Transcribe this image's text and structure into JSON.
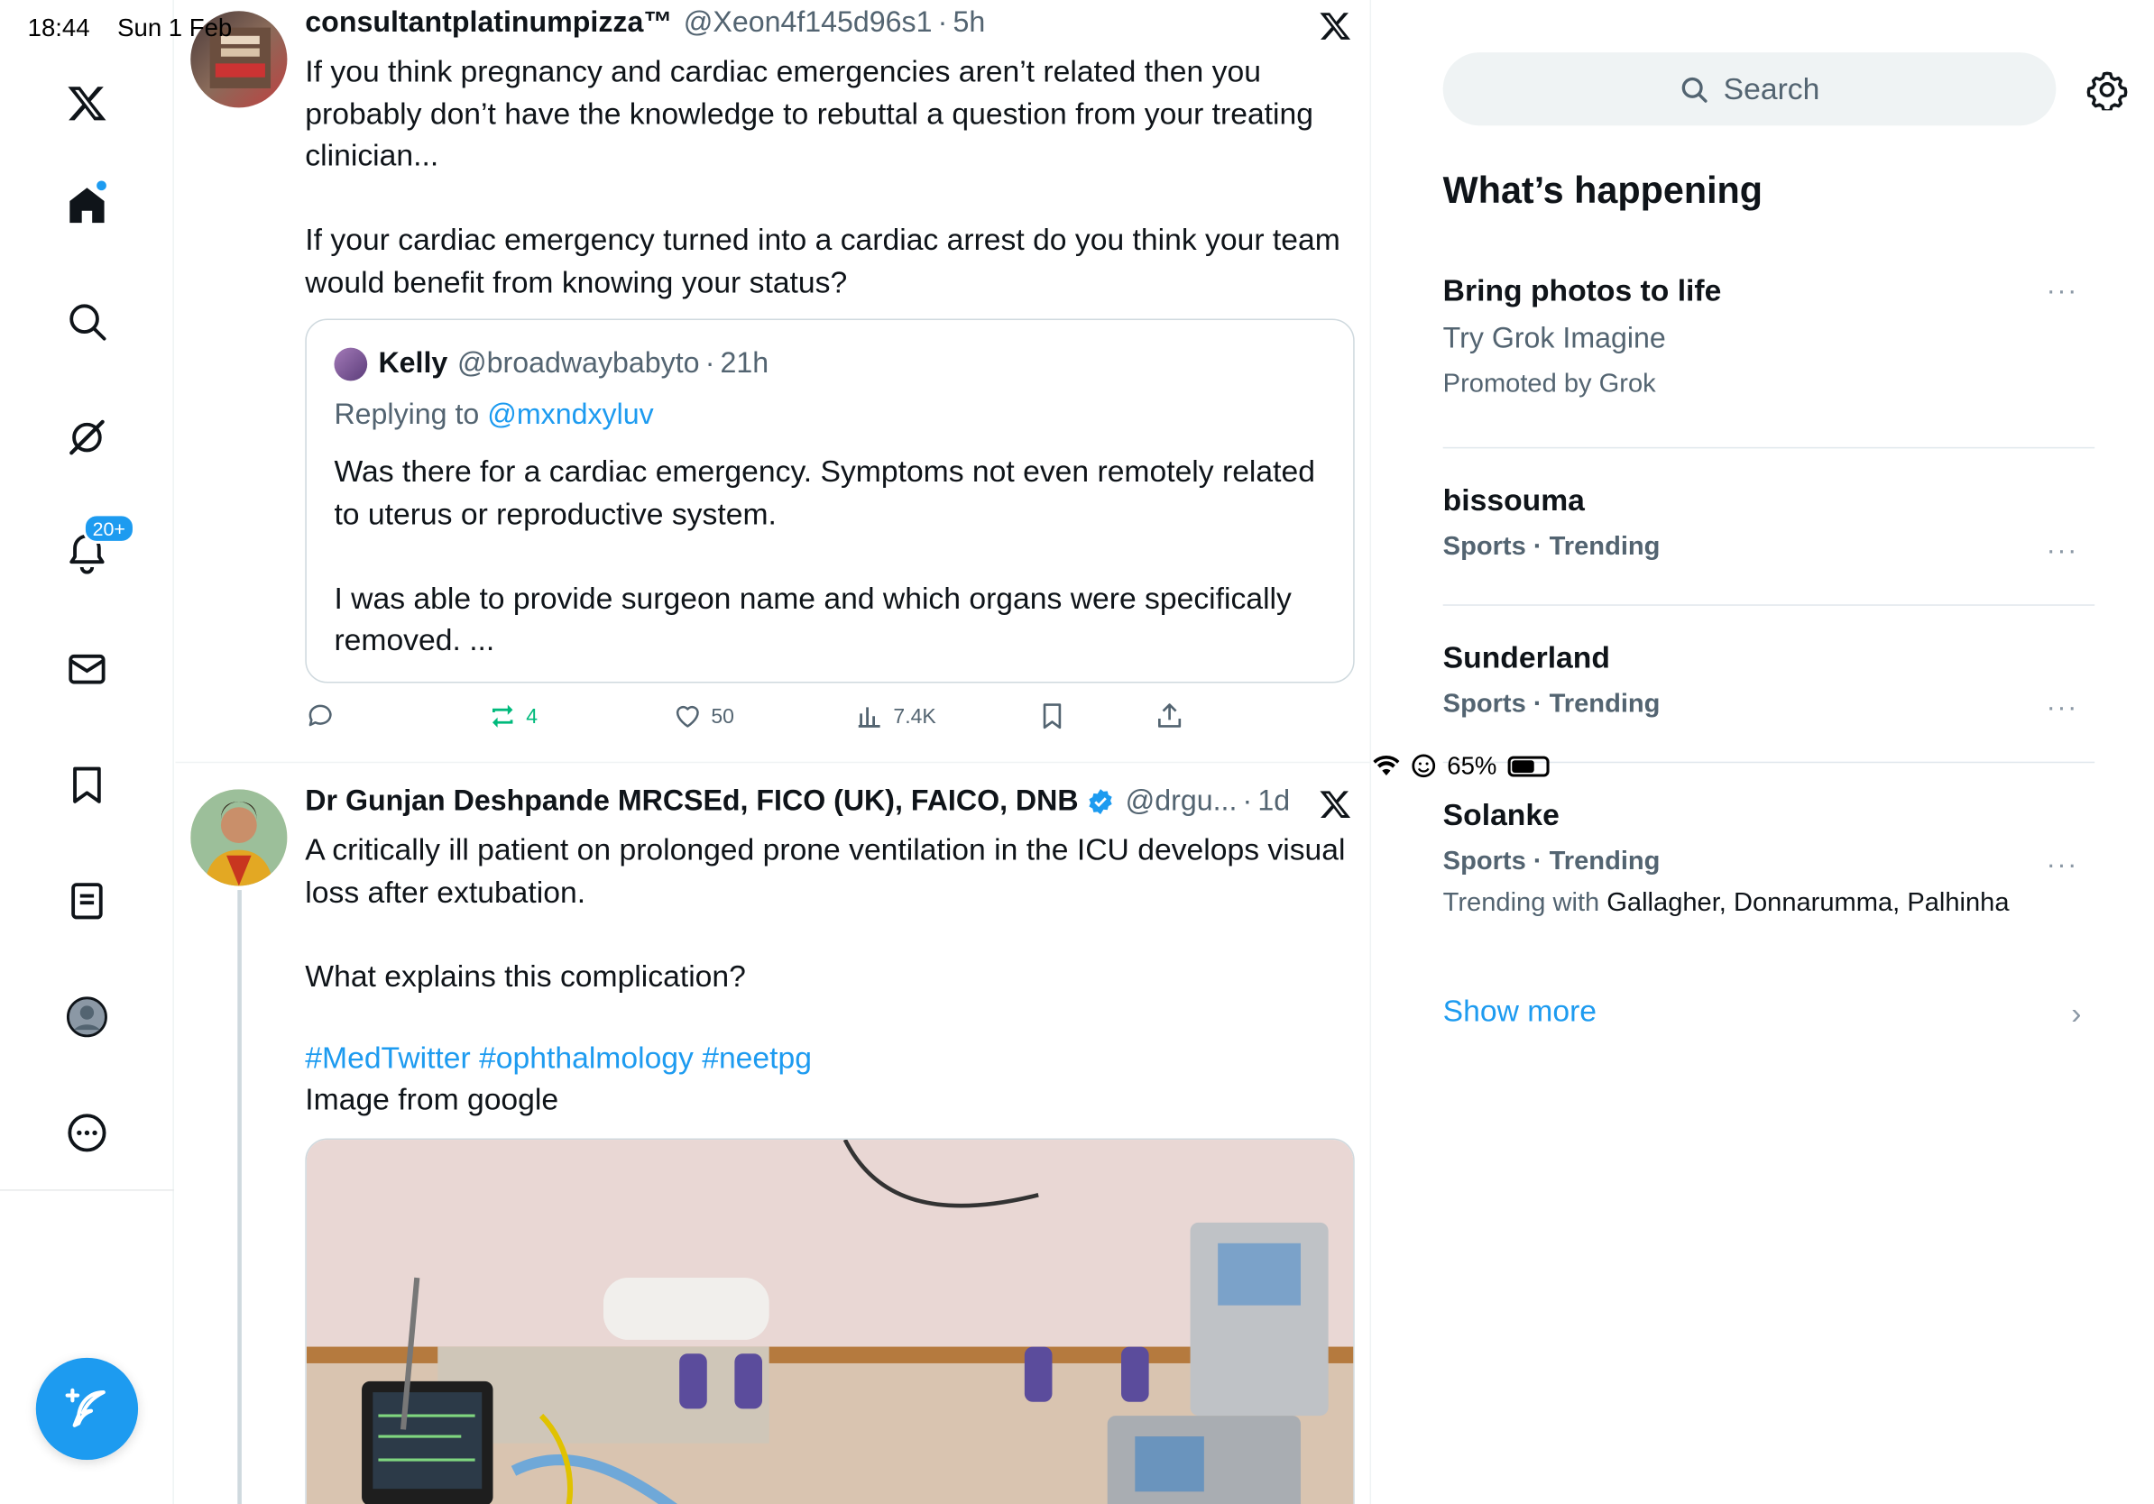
{
  "status_bar": {
    "time": "18:44",
    "date": "Sun 1 Feb",
    "battery": "65%"
  },
  "nav": {
    "notifications_badge": "20+"
  },
  "tweet1": {
    "name": "consultantplatinumpizza™",
    "handle": "@Xeon4f145d96s1",
    "time": "5h",
    "text": "If you think pregnancy and cardiac emergencies aren’t related then you probably don’t have the knowledge to rebuttal a question from your treating clinician...\n\nIf your cardiac emergency turned into a cardiac arrest do you think your team would benefit from knowing your status?",
    "quote": {
      "name": "Kelly",
      "handle": "@broadwaybabyto",
      "time": "21h",
      "replying_prefix": "Replying to",
      "replying_to": "@mxndxyluv",
      "text": "Was there for a cardiac emergency. Symptoms not even remotely related to uterus or reproductive system.\n\nI was able to provide surgeon name and which organs were specifically removed. ..."
    },
    "actions": {
      "retweets": "4",
      "likes": "50",
      "views": "7.4K"
    }
  },
  "tweet2": {
    "name": "Dr Gunjan Deshpande MRCSEd, FICO (UK), FAICO, DNB",
    "handle": "@drgu...",
    "time": "1d",
    "text_1": "A critically ill patient on prolonged prone ventilation in the ICU develops visual loss after extubation.\n\nWhat explains this complication?",
    "hashtags": "#MedTwitter #ophthalmology #neetpg",
    "text_2": "Image from google"
  },
  "sidebar": {
    "search_placeholder": "Search",
    "title": "What’s happening",
    "promo": {
      "title": "Bring photos to life",
      "subtitle": "Try Grok Imagine",
      "promoted": "Promoted by Grok"
    },
    "trends": [
      {
        "name": "bissouma",
        "meta": "Sports · Trending"
      },
      {
        "name": "Sunderland",
        "meta": "Sports · Trending"
      },
      {
        "name": "Solanke",
        "meta": "Sports · Trending",
        "with_prefix": "Trending with",
        "with_names": "Gallagher, Donnarumma, Palhinha"
      }
    ],
    "show_more": "Show more"
  },
  "colors": {
    "accent": "#1d9bf0",
    "retweet_green": "#00ba7c",
    "text_secondary": "#536471"
  }
}
